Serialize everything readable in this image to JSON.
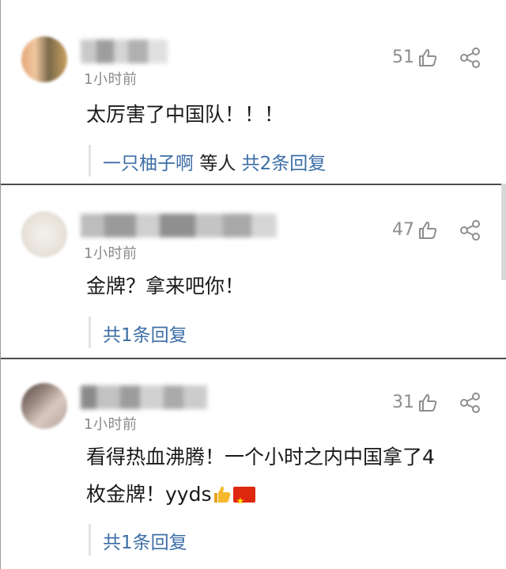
{
  "comments": [
    {
      "time": "1小时前",
      "likes": "51",
      "text": "太厉害了中国队！！！",
      "reply": {
        "user": "一只柚子啊",
        "mid": "等人",
        "count": "共2条回复"
      }
    },
    {
      "time": "1小时前",
      "likes": "47",
      "text": "金牌？拿来吧你！",
      "reply": {
        "count": "共1条回复"
      }
    },
    {
      "time": "1小时前",
      "likes": "31",
      "text_line1": "看得热血沸腾！一个小时之内中国拿了4",
      "text_line2": "枚金牌！yyds",
      "reply": {
        "count": "共1条回复"
      }
    }
  ],
  "icons": {
    "like": "thumb-up-icon",
    "share": "share-icon"
  },
  "colors": {
    "link": "#3c6ea6",
    "muted": "#8a8a8a"
  }
}
